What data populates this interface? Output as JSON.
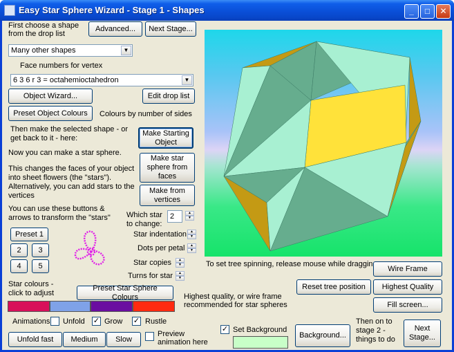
{
  "window": {
    "title": "Easy Star Sphere Wizard - Stage 1 -  Shapes"
  },
  "titlebar_buttons": {
    "minimize": "_",
    "maximize": "□",
    "close": "✕"
  },
  "left": {
    "intro_line1": "First choose a shape",
    "intro_line2": "from the drop list",
    "advanced": "Advanced...",
    "next_stage": "Next Stage...",
    "shape_combo": "Many other shapes",
    "face_numbers_label": "Face numbers for vertex",
    "vertex_combo": "6 3 6 r 3 = octahemioctahedron",
    "object_wizard": "Object Wizard...",
    "edit_drop_list": "Edit drop list",
    "preset_colours": "Preset Object Colours",
    "colours_by_sides": "Colours by number of sides",
    "make_selected_1": "Then make the selected shape - or",
    "make_selected_2": "get back to it - here:",
    "make_starting": "Make Starting Object",
    "now_make": "Now you can make a star sphere.",
    "changes_1": "This changes the faces of your object",
    "changes_2": "into sheet flowers (the \"stars\").",
    "changes_3": "Alternatively, you can add stars to the",
    "changes_4": "vertices",
    "star_from_faces": "Make star sphere from faces",
    "make_from_vertices": "Make from vertices",
    "use_buttons_1": "You can use these buttons &",
    "use_buttons_2": "arrows to transform the \"stars\"",
    "which_star_1": "Which star",
    "which_star_2": "to change:",
    "which_star_value": "2",
    "preset1": "Preset 1",
    "p2": "2",
    "p3": "3",
    "p4": "4",
    "p5": "5",
    "star_indentation": "Star indentation",
    "dots_per_petal": "Dots per petal",
    "star_copies": "Star copies",
    "turns_for_star": "Turns for star",
    "star_colours_1": "Star colours -",
    "star_colours_2": "click to adjust",
    "preset_star_colours": "Preset Star Sphere Colours",
    "animations": "Animations",
    "unfold": "Unfold",
    "grow": "Grow",
    "rustle": "Rustle",
    "unfold_fast": "Unfold fast",
    "medium": "Medium",
    "slow": "Slow",
    "preview_1": "Preview",
    "preview_2": "animation here",
    "check_mark": "✓"
  },
  "right": {
    "spin_hint": "To set tree spinning, release mouse while dragging",
    "wire_frame": "Wire Frame",
    "reset_tree": "Reset tree position",
    "highest_quality": "Highest Quality",
    "hq_note_1": "Highest quality, or wire frame",
    "hq_note_2": "recommended for star spheres",
    "fill_screen": "Fill screen...",
    "set_background": "Set Background",
    "background_btn": "Background...",
    "then_on_1": "Then on to",
    "then_on_2": "stage 2 -",
    "then_on_3": "things to do",
    "next_stage_btn": "Next Stage..."
  },
  "states": {
    "unfold": false,
    "grow": true,
    "rustle": true,
    "preview": false,
    "set_background": true
  },
  "colors": {
    "swatches": [
      "#d8105a",
      "#7fa2e8",
      "#6a0ea0",
      "#ff2a10"
    ],
    "background_color": "#c8ffc8",
    "shape_yellow": "#ffe23a",
    "shape_olive": "#c49a14",
    "shape_green": "#66ad8e",
    "shape_mint": "#a8f0d2",
    "star_magenta": "#e020e8"
  }
}
